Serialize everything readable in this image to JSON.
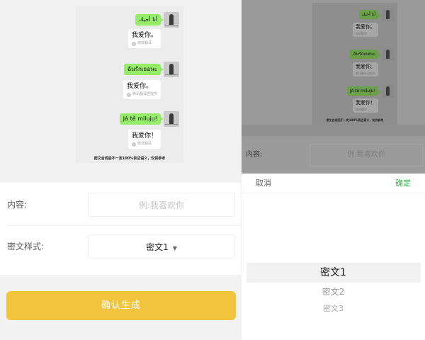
{
  "chat_preview": {
    "messages": [
      {
        "text": "أنا أحبك",
        "translation": "我爱你。",
        "source": "微软翻译"
      },
      {
        "text": "ฉันรักเธอนะ",
        "translation": "我爱你。",
        "source": "腾讯翻译君提供"
      },
      {
        "text": "Já tě miluju!",
        "translation": "我爱你！",
        "source": "微软翻译"
      }
    ],
    "disclaimer": "密文合成后不一定100%表达语义，仅供参考"
  },
  "form": {
    "content_label": "内容:",
    "content_placeholder": "例:我喜欢你",
    "style_label": "密文样式:",
    "style_value": "密文1",
    "style_caret": "▼"
  },
  "confirm_button": "确认生成",
  "picker": {
    "cancel": "取消",
    "ok": "确定",
    "options": [
      "密文1",
      "密文2",
      "密文3"
    ]
  },
  "right_form": {
    "content_label": "内容:",
    "content_placeholder": "例:我喜欢你"
  },
  "colors": {
    "bubble_green": "#95ec69",
    "confirm_yellow": "#f2c33d",
    "ok_green": "#2fbc4a"
  }
}
